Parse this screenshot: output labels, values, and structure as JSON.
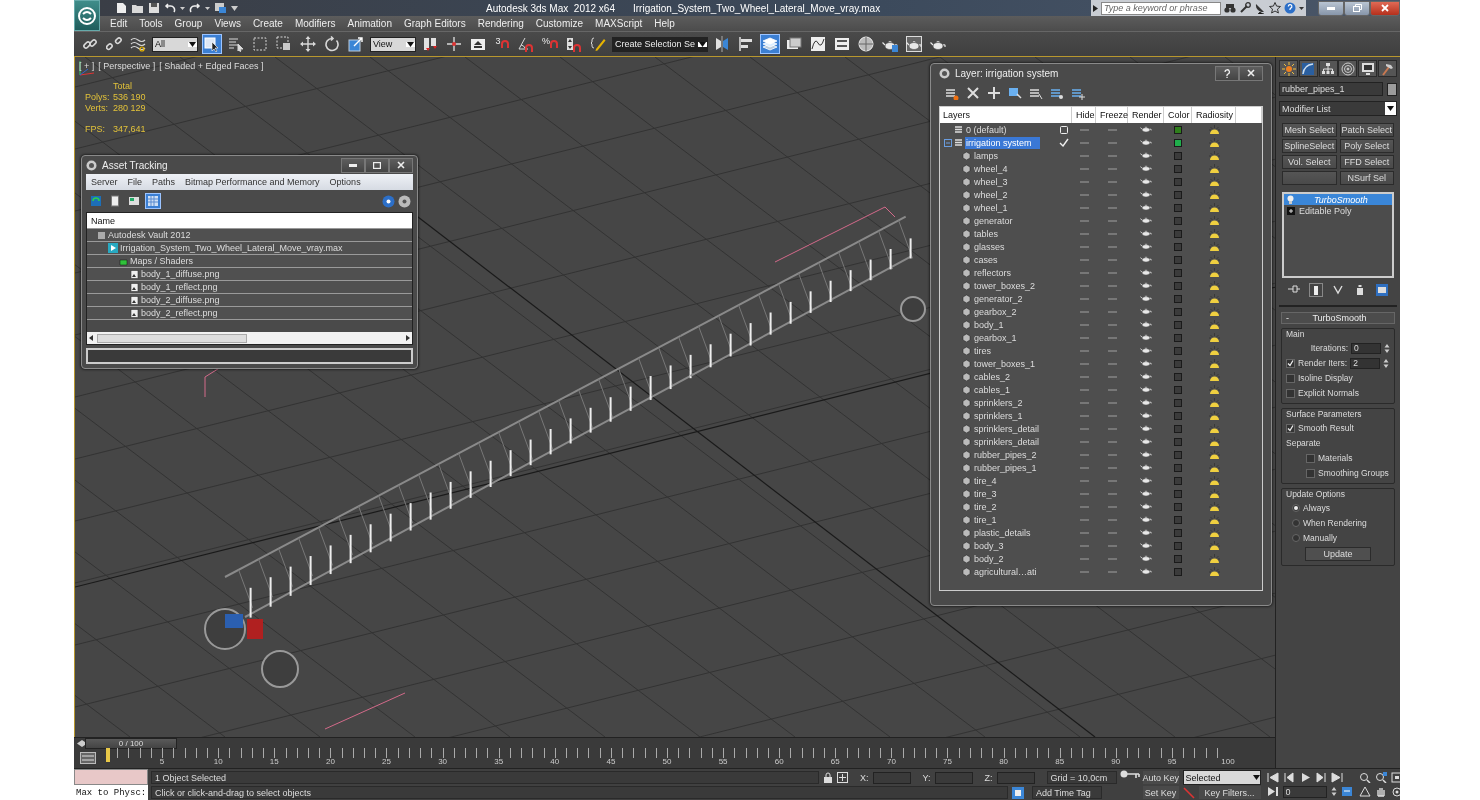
{
  "window": {
    "title": "Autodesk 3ds Max  2012 x64",
    "file": "Irrigation_System_Two_Wheel_Lateral_Move_vray.max"
  },
  "search": {
    "placeholder": "Type a keyword or phrase"
  },
  "menu": [
    "Edit",
    "Tools",
    "Group",
    "Views",
    "Create",
    "Modifiers",
    "Animation",
    "Graph Editors",
    "Rendering",
    "Customize",
    "MAXScript",
    "Help"
  ],
  "main_toolbar": [
    {
      "kind": "link",
      "selected": false
    },
    {
      "kind": "unlink",
      "selected": false
    },
    {
      "kind": "bind",
      "selected": false
    },
    {
      "kind": "dropdown",
      "value": "All"
    },
    {
      "kind": "select",
      "selected": true
    },
    {
      "kind": "selectbyname",
      "selected": false
    },
    {
      "kind": "region",
      "selected": false
    },
    {
      "kind": "window",
      "selected": false
    },
    {
      "kind": "move",
      "selected": false
    },
    {
      "kind": "rotate",
      "selected": false
    },
    {
      "kind": "scale",
      "selected": false
    },
    {
      "kind": "dropdown",
      "value": "View"
    },
    {
      "kind": "pivot",
      "selected": false
    },
    {
      "kind": "manipulate",
      "selected": false
    },
    {
      "kind": "keyboard",
      "selected": false
    },
    {
      "kind": "snap",
      "label": "3",
      "selected": false
    },
    {
      "kind": "anglesnap",
      "selected": false
    },
    {
      "kind": "percentsnap",
      "label": "%",
      "selected": false
    },
    {
      "kind": "spinnersnap",
      "selected": false
    },
    {
      "kind": "namedsel",
      "selected": false
    },
    {
      "kind": "dropdown",
      "value": "Create Selection Se"
    },
    {
      "kind": "mirror",
      "selected": false
    },
    {
      "kind": "align",
      "selected": false
    },
    {
      "kind": "layers",
      "selected": true
    },
    {
      "kind": "ribbon",
      "selected": false
    },
    {
      "kind": "curve",
      "selected": false
    },
    {
      "kind": "schematic",
      "selected": false
    },
    {
      "kind": "material",
      "selected": false
    },
    {
      "kind": "rendersetup",
      "selected": false
    },
    {
      "kind": "frame",
      "selected": false
    },
    {
      "kind": "render",
      "selected": false
    }
  ],
  "viewport": {
    "labels": [
      "[ + ]",
      "[ Perspective ]",
      "[ Shaded + Edged Faces ]"
    ],
    "stats_header": "Total",
    "stats": [
      {
        "label": "Polys:",
        "value": "536 190"
      },
      {
        "label": "Verts:",
        "value": "280 129"
      }
    ],
    "fps": {
      "label": "FPS:",
      "value": "347,641"
    }
  },
  "asset_tracking": {
    "title": "Asset Tracking",
    "menu": [
      "Server",
      "File",
      "Paths",
      "Bitmap Performance and Memory",
      "Options"
    ],
    "toolbar": [
      {
        "selected": false
      },
      {
        "selected": false
      },
      {
        "selected": false
      },
      {
        "selected": true
      }
    ],
    "column": "Name",
    "tree": [
      {
        "kind": "vault",
        "name": "Autodesk Vault 2012",
        "children": [
          {
            "kind": "scene",
            "name": "Irrigation_System_Two_Wheel_Lateral_Move_vray.max",
            "children": [
              {
                "kind": "folder",
                "name": "Maps / Shaders",
                "children": [
                  {
                    "kind": "bitmap",
                    "name": "body_1_diffuse.png"
                  },
                  {
                    "kind": "bitmap",
                    "name": "body_1_reflect.png"
                  },
                  {
                    "kind": "bitmap",
                    "name": "body_2_diffuse.png"
                  },
                  {
                    "kind": "bitmap",
                    "name": "body_2_reflect.png"
                  }
                ]
              }
            ]
          }
        ]
      }
    ]
  },
  "layer_manager": {
    "title": "Layer: irrigation system",
    "columns": [
      "Layers",
      "Hide",
      "Freeze",
      "Render",
      "Color",
      "Radiosity"
    ],
    "layers": [
      {
        "name": "0 (default)",
        "selected": false,
        "current": false,
        "color": "#2f7f1c"
      },
      {
        "name": "irrigation system",
        "selected": true,
        "current": true,
        "expanded": true,
        "color": "#1fae4b",
        "children": [
          {
            "name": "lamps",
            "selected": false,
            "color": "#3b3b3b"
          },
          {
            "name": "wheel_4",
            "selected": false,
            "color": "#3b3b3b"
          },
          {
            "name": "wheel_3",
            "selected": false,
            "color": "#3b3b3b"
          },
          {
            "name": "wheel_2",
            "selected": false,
            "color": "#3b3b3b"
          },
          {
            "name": "wheel_1",
            "selected": false,
            "color": "#3b3b3b"
          },
          {
            "name": "generator",
            "selected": false,
            "color": "#3b3b3b"
          },
          {
            "name": "tables",
            "selected": false,
            "color": "#3b3b3b"
          },
          {
            "name": "glasses",
            "selected": false,
            "color": "#3b3b3b"
          },
          {
            "name": "cases",
            "selected": false,
            "color": "#3b3b3b"
          },
          {
            "name": "reflectors",
            "selected": false,
            "color": "#3b3b3b"
          },
          {
            "name": "tower_boxes_2",
            "selected": false,
            "color": "#3b3b3b"
          },
          {
            "name": "generator_2",
            "selected": false,
            "color": "#3b3b3b"
          },
          {
            "name": "gearbox_2",
            "selected": false,
            "color": "#3b3b3b"
          },
          {
            "name": "body_1",
            "selected": false,
            "color": "#3b3b3b"
          },
          {
            "name": "gearbox_1",
            "selected": false,
            "color": "#3b3b3b"
          },
          {
            "name": "tires",
            "selected": false,
            "color": "#3b3b3b"
          },
          {
            "name": "tower_boxes_1",
            "selected": false,
            "color": "#3b3b3b"
          },
          {
            "name": "cables_2",
            "selected": false,
            "color": "#3b3b3b"
          },
          {
            "name": "cables_1",
            "selected": false,
            "color": "#3b3b3b"
          },
          {
            "name": "sprinklers_2",
            "selected": false,
            "color": "#3b3b3b"
          },
          {
            "name": "sprinklers_1",
            "selected": false,
            "color": "#3b3b3b"
          },
          {
            "name": "sprinklers_detail",
            "selected": false,
            "color": "#3b3b3b"
          },
          {
            "name": "sprinklers_detail",
            "selected": false,
            "color": "#3b3b3b"
          },
          {
            "name": "rubber_pipes_2",
            "selected": false,
            "color": "#3b3b3b"
          },
          {
            "name": "rubber_pipes_1",
            "selected": false,
            "color": "#3b3b3b"
          },
          {
            "name": "tire_4",
            "selected": false,
            "color": "#3b3b3b"
          },
          {
            "name": "tire_3",
            "selected": false,
            "color": "#3b3b3b"
          },
          {
            "name": "tire_2",
            "selected": false,
            "color": "#3b3b3b"
          },
          {
            "name": "tire_1",
            "selected": false,
            "color": "#3b3b3b"
          },
          {
            "name": "plastic_details",
            "selected": false,
            "color": "#3b3b3b"
          },
          {
            "name": "body_3",
            "selected": false,
            "color": "#3b3b3b"
          },
          {
            "name": "body_2",
            "selected": false,
            "color": "#3b3b3b"
          },
          {
            "name": "agricultural…ati",
            "selected": false,
            "color": "#3b3b3b"
          }
        ]
      }
    ]
  },
  "command_panel": {
    "object_name": "rubber_pipes_1",
    "modifier_list": "Modifier List",
    "modifier_buttons": [
      {
        "kind": "button",
        "label": "Mesh Select"
      },
      {
        "kind": "button",
        "label": "Patch Select"
      },
      {
        "kind": "button",
        "label": "SplineSelect"
      },
      {
        "kind": "button",
        "label": "Poly Select"
      },
      {
        "kind": "button",
        "label": "Vol. Select"
      },
      {
        "kind": "button",
        "label": "FFD Select"
      },
      {
        "kind": "blank"
      },
      {
        "kind": "button",
        "label": "NSurf Sel"
      }
    ],
    "stack": [
      {
        "kind": "modifier",
        "name": "TurboSmooth",
        "selected": true
      },
      {
        "kind": "base",
        "name": "Editable Poly",
        "selected": false
      }
    ],
    "rollout": {
      "title": "TurboSmooth",
      "collapse": "-",
      "groups": [
        {
          "title": "Main",
          "items": [
            {
              "kind": "spinner",
              "label": "Iterations:",
              "value": "0"
            },
            {
              "kind": "checkspinner",
              "label": "Render Iters:",
              "checked": true,
              "value": "2"
            },
            {
              "kind": "checkbox",
              "label": "Isoline Display",
              "checked": false
            },
            {
              "kind": "checkbox",
              "label": "Explicit Normals",
              "checked": false
            }
          ]
        },
        {
          "title": "Surface Parameters",
          "items": [
            {
              "kind": "checkbox",
              "label": "Smooth Result",
              "checked": true
            },
            {
              "kind": "label",
              "label": "Separate"
            },
            {
              "kind": "subcheckbox",
              "label": "Materials",
              "checked": false
            },
            {
              "kind": "subcheckbox",
              "label": "Smoothing Groups",
              "checked": false
            }
          ]
        },
        {
          "title": "Update Options",
          "items": [
            {
              "kind": "radio",
              "label": "Always",
              "selected": true
            },
            {
              "kind": "radio",
              "label": "When Rendering",
              "selected": false
            },
            {
              "kind": "radio",
              "label": "Manually",
              "selected": false
            },
            {
              "kind": "button",
              "label": "Update"
            }
          ]
        }
      ]
    }
  },
  "time_slider": {
    "label": "0 / 100",
    "level": 0
  },
  "ruler_labels": [
    "5",
    "10",
    "15",
    "20",
    "25",
    "30",
    "35",
    "40",
    "45",
    "50",
    "55",
    "60",
    "65",
    "70",
    "75",
    "80",
    "85",
    "90",
    "95",
    "100"
  ],
  "status": {
    "listener": "Max to Physc:",
    "selection": "1 Object Selected",
    "prompt": "Click or click-and-drag to select objects",
    "coords": [
      "X:",
      "Y:",
      "Z:"
    ],
    "grid": "Grid = 10,0cm",
    "add_time_tag": "Add Time Tag",
    "auto_key": "Auto Key",
    "key_mode": "Selected",
    "set_key": "Set Key",
    "key_filters": "Key Filters...",
    "current_frame": "0"
  }
}
